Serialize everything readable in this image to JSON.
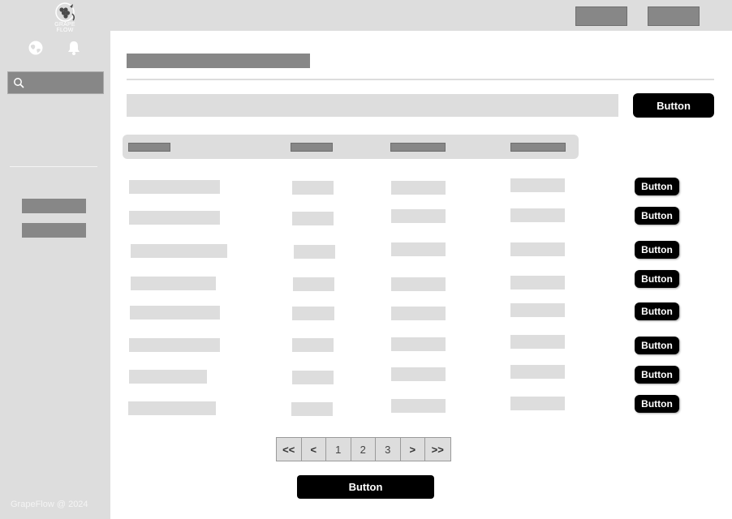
{
  "app": {
    "logo_text": "GRAPE FLOW",
    "footer_text": "GrapeFlow @ 2024"
  },
  "sidebar": {
    "search": {
      "placeholder": "",
      "value": ""
    },
    "icons": [
      "globe-icon",
      "bell-icon",
      "search-icon"
    ]
  },
  "toolbar": {
    "main_button_label": "Button"
  },
  "table": {
    "row_count": 8,
    "row_button_label": "Button"
  },
  "pagination": {
    "first_label": "<<",
    "prev_label": "<",
    "pages": [
      "1",
      "2",
      "3"
    ],
    "next_label": ">",
    "last_label": ">>"
  },
  "footer_action": {
    "button_label": "Button"
  },
  "colors": {
    "placeholder_dark": "#878787",
    "placeholder_light": "#dddddd",
    "button_black": "#000000",
    "background": "#ffffff"
  }
}
